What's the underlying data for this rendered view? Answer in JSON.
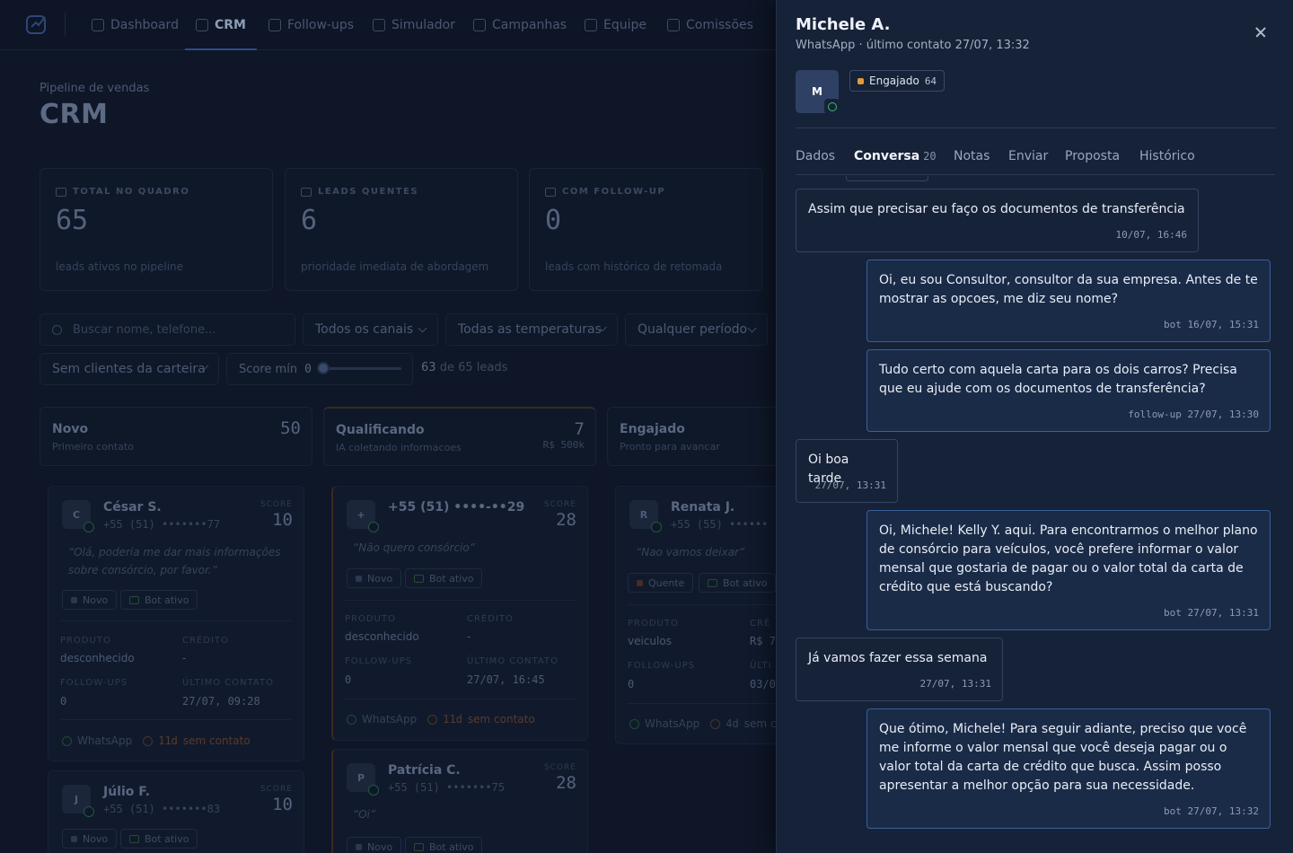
{
  "nav": {
    "items": [
      {
        "label": "Dashboard",
        "active": false
      },
      {
        "label": "CRM",
        "active": true
      },
      {
        "label": "Follow-ups",
        "active": false
      },
      {
        "label": "Simulador",
        "active": false
      },
      {
        "label": "Campanhas",
        "active": false
      },
      {
        "label": "Equipe",
        "active": false
      },
      {
        "label": "Comissões",
        "active": false
      }
    ]
  },
  "page": {
    "subtitle": "Pipeline de vendas",
    "title": "CRM"
  },
  "stats": [
    {
      "label": "TOTAL NO QUADRO",
      "value": "65",
      "desc": "leads ativos no pipeline"
    },
    {
      "label": "LEADS QUENTES",
      "value": "6",
      "desc": "prioridade imediata de abordagem"
    },
    {
      "label": "COM FOLLOW-UP",
      "value": "0",
      "desc": "leads com histórico de retomada"
    }
  ],
  "filters": {
    "search_placeholder": "Buscar nome, telefone...",
    "channels": "Todos os canais",
    "temperatures": "Todas as temperaturas",
    "period": "Qualquer período",
    "wallet": "Sem clientes da carteira",
    "score_label": "Score mín",
    "score_value": "0",
    "score_fraction": 0,
    "lead_count_shown": "63",
    "lead_count_rest": "de 65 leads"
  },
  "columns": [
    {
      "title": "Novo",
      "sub": "Primeiro contato",
      "count": "50",
      "amount": ""
    },
    {
      "title": "Qualificando",
      "sub": "IA coletando informacoes",
      "count": "7",
      "amount": "R$ 500k"
    },
    {
      "title": "Engajado",
      "sub": "Pronto para avancar",
      "count": "",
      "amount": ""
    }
  ],
  "card_labels": {
    "score": "SCORE",
    "produto": "PRODUTO",
    "credito": "CRÉDITO",
    "followups": "FOLLOW-UPS",
    "ultimo": "ÚLTIMO CONTATO",
    "channel": "WhatsApp",
    "no_contact": "sem contato",
    "bot": "Bot ativo"
  },
  "cards": [
    {
      "initial": "C",
      "name": "César S.",
      "phone": "+55 (51) •••••••77",
      "score": "10",
      "quote": "“Olá, poderia me dar mais informações sobre consórcio, por favor.”",
      "temp": "Novo",
      "produto": "desconhecido",
      "credito": "-",
      "followups": "0",
      "ultimo": "27/07, 09:28",
      "age": "11d"
    },
    {
      "initial": "J",
      "name": "Júlio F.",
      "phone": "+55 (51) •••••••83",
      "score": "10",
      "temp": "Novo"
    },
    {
      "initial": "+",
      "name": "+55 (51) ••••-••29",
      "phone": "",
      "score": "28",
      "quote": "“Não quero consórcio”",
      "temp": "Novo",
      "produto": "desconhecido",
      "credito": "-",
      "followups": "0",
      "ultimo": "27/07, 16:45",
      "age": "11d"
    },
    {
      "initial": "P",
      "name": "Patrícia C.",
      "phone": "+55 (51) •••••••75",
      "score": "28",
      "quote": "“Oi”",
      "temp": "Novo"
    },
    {
      "initial": "R",
      "name": "Renata J.",
      "phone": "+55 (55) ••••••",
      "score": "",
      "quote": "“Nao vamos deixar”",
      "temp": "Quente",
      "produto": "veiculos",
      "credito": "R$ 7",
      "followups": "0",
      "ultimo": "03/0",
      "age": "4d",
      "foot_rest": "sem c",
      "cred_label": "CRÉ",
      "ult_label": "ÚLTI"
    }
  ],
  "drawer": {
    "name": "Michele A.",
    "meta": "WhatsApp · último contato 27/07, 13:32",
    "avatar": "M",
    "badge_label": "Engajado",
    "badge_score": "64",
    "accent": "#e09a3c",
    "tabs": [
      {
        "label": "Dados",
        "count": ""
      },
      {
        "label": "Conversa",
        "count": "20"
      },
      {
        "label": "Notas",
        "count": ""
      },
      {
        "label": "Enviar",
        "count": ""
      },
      {
        "label": "Proposta",
        "count": ""
      },
      {
        "label": "Histórico",
        "count": ""
      }
    ],
    "active_tab": "Conversa",
    "messages": [
      {
        "dir": "in",
        "text": "Assim que precisar eu faço os documentos de transferência",
        "time": "10/07, 16:46"
      },
      {
        "dir": "out",
        "text": "Oi, eu sou Consultor, consultor da sua empresa. Antes de te mostrar as opcoes, me diz seu nome?",
        "time": "bot 16/07, 15:31"
      },
      {
        "dir": "out",
        "text": "Tudo certo com aquela carta para os dois carros? Precisa que eu ajude com os documentos de transferência?",
        "time": "follow-up 27/07, 13:30"
      },
      {
        "dir": "in",
        "text": "Oi boa tarde",
        "time": "27/07, 13:31"
      },
      {
        "dir": "out",
        "text": "Oi, Michele! Kelly Y. aqui. Para encontrarmos o melhor plano de consórcio para veículos, você prefere informar o valor mensal que gostaria de pagar ou o valor total da carta de crédito que está buscando?",
        "time": "bot 27/07, 13:31"
      },
      {
        "dir": "in",
        "text": "Já vamos fazer essa semana",
        "time": "27/07, 13:31"
      },
      {
        "dir": "out",
        "text": "Que ótimo, Michele! Para seguir adiante, preciso que você me informe o valor mensal que você deseja pagar ou o valor total da carta de crédito que busca. Assim posso apresentar a melhor opção para sua necessidade.",
        "time": "bot 27/07, 13:32"
      }
    ]
  }
}
